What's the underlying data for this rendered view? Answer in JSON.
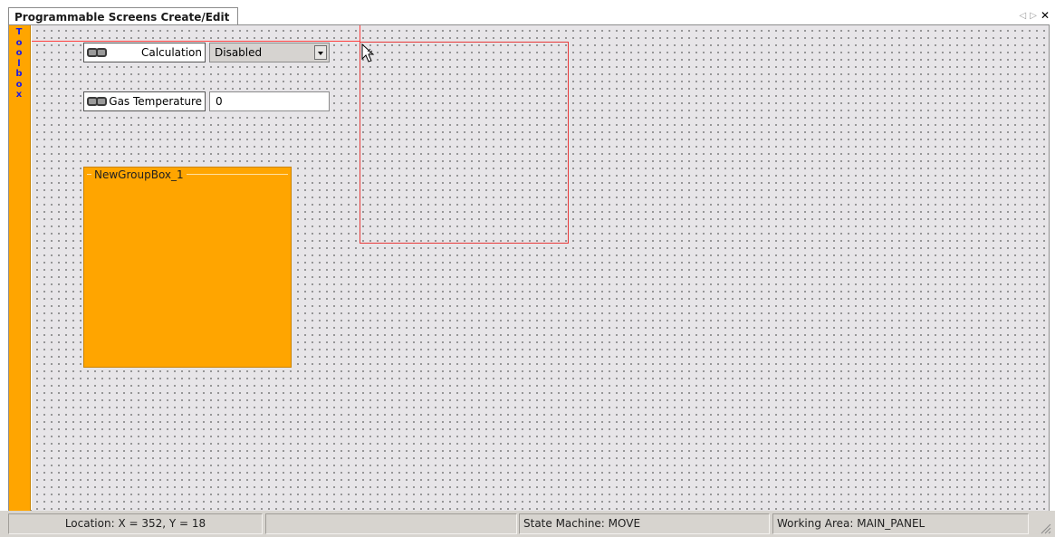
{
  "tab": {
    "title": "Programmable Screens Create/Edit",
    "prev_icon": "triangle-left-icon",
    "next_icon": "triangle-right-icon",
    "close_icon": "close-icon",
    "prev_glyph": "◁",
    "next_glyph": "▷",
    "close_glyph": "✕"
  },
  "toolbox": {
    "label": "T\no\no\nl\nb\no\nx"
  },
  "canvas": {
    "fields": [
      {
        "label": "Calculation",
        "control": "dropdown",
        "value": "Disabled",
        "icon": "chain-link-icon"
      },
      {
        "label": "Gas Temperature",
        "control": "text-input",
        "value": "0",
        "icon": "chain-link-icon"
      }
    ],
    "groupbox": {
      "title": "NewGroupBox_1"
    }
  },
  "status": {
    "location": "Location: X = 352, Y = 18",
    "blank": "",
    "state_machine": "State Machine: MOVE",
    "working_area": "Working Area: MAIN_PANEL"
  },
  "colors": {
    "accent": "#ffa500",
    "canvas_bg": "#e7e5e8",
    "selection": "#e83a3a",
    "toolbox_text": "#1a1ae6",
    "statusbar": "#d7d4cf"
  }
}
